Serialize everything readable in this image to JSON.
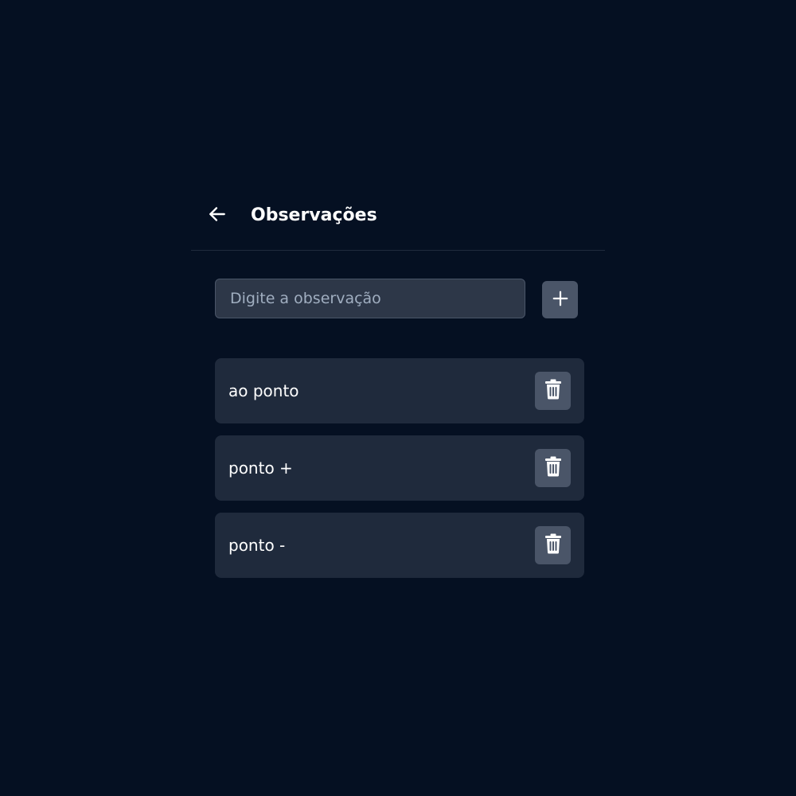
{
  "header": {
    "back_icon": "arrow-left-icon",
    "title": "Observações"
  },
  "add_form": {
    "placeholder": "Digite a observação",
    "value": "",
    "add_icon": "plus-icon"
  },
  "observations": [
    {
      "label": "ao ponto",
      "delete_icon": "trash-icon"
    },
    {
      "label": "ponto +",
      "delete_icon": "trash-icon"
    },
    {
      "label": "ponto -",
      "delete_icon": "trash-icon"
    }
  ],
  "colors": {
    "background": "#051022",
    "card": "#1f2a3c",
    "input_bg": "#2d3748",
    "button_bg": "#4a5568",
    "text": "#ffffff",
    "placeholder": "#a0aec0"
  }
}
